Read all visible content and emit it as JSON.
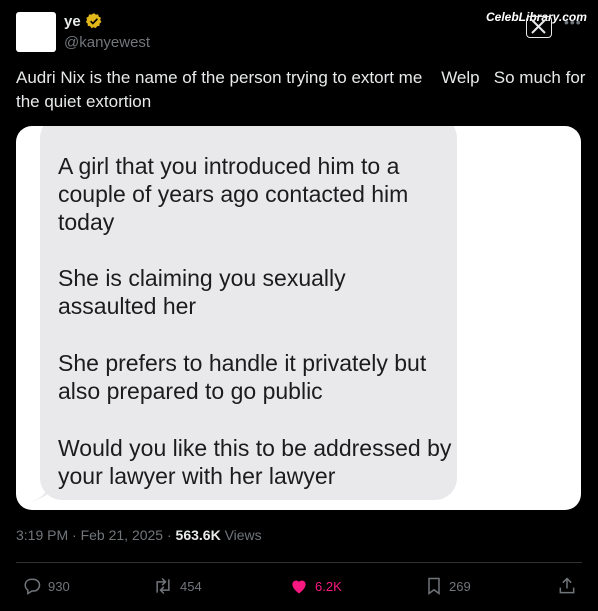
{
  "author": {
    "display_name": "ye",
    "handle": "@kanyewest",
    "verified_icon": "verified-badge-icon"
  },
  "watermark": "CelebLibrary.com",
  "tweet": {
    "text": "Audri Nix is the name of the person trying to extort me    Welp   So much for the quiet extortion"
  },
  "media": {
    "messages": [
      "A girl that you introduced him to a couple of years ago contacted him today",
      "She is claiming you sexually assaulted her",
      "She prefers to handle it privately but also prepared to go public",
      "Would you like this to be addressed by your lawyer with her lawyer"
    ]
  },
  "meta": {
    "time": "3:19 PM · Feb 21, 2025 · ",
    "views_count": "563.6K",
    "views_label": " Views"
  },
  "actions": {
    "replies": "930",
    "reposts": "454",
    "likes": "6.2K",
    "bookmarks": "269"
  },
  "colors": {
    "background": "#000000",
    "like_active": "#f91880",
    "bubble": "#e9e9eb"
  }
}
